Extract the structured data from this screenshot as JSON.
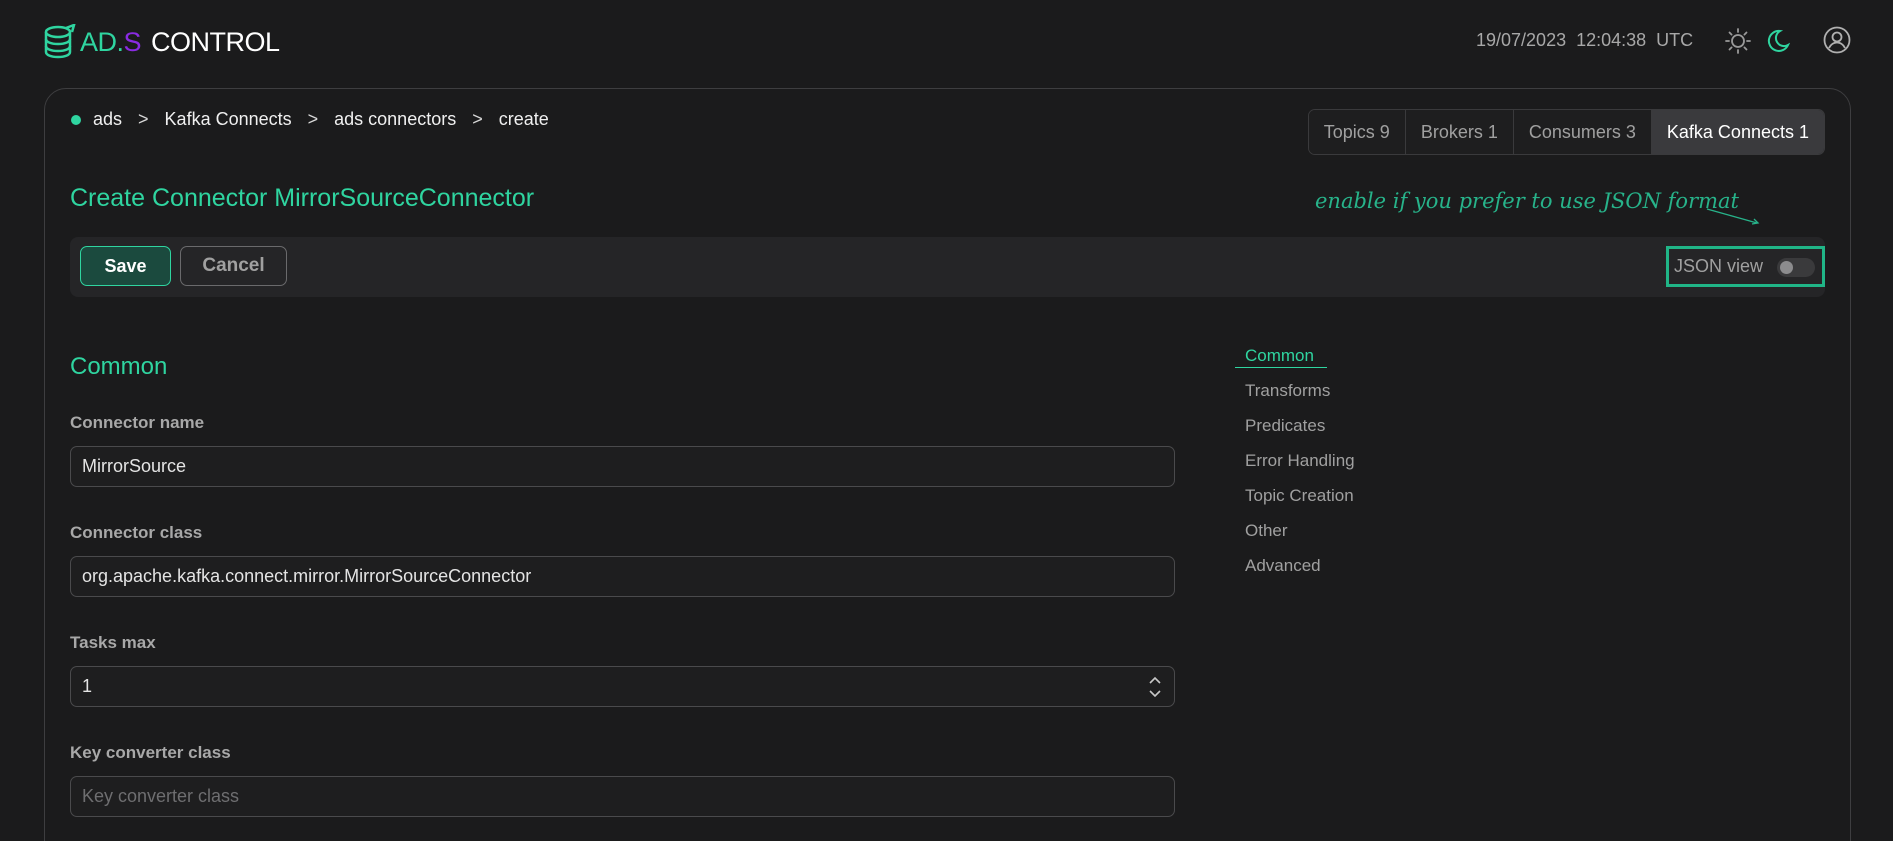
{
  "brand": {
    "ad": "AD",
    "dot": ".",
    "s": "S",
    "control": "CONTROL"
  },
  "header": {
    "date": "19/07/2023",
    "time": "12:04:38",
    "timezone": "UTC",
    "icons": [
      "logo-icon",
      "sun-icon",
      "moon-icon",
      "user-icon"
    ]
  },
  "breadcrumb": {
    "items": [
      "ads",
      "Kafka Connects",
      "ads connectors",
      "create"
    ],
    "separator": ">"
  },
  "top_tabs": [
    {
      "label": "Topics 9",
      "active": false
    },
    {
      "label": "Brokers 1",
      "active": false
    },
    {
      "label": "Consumers 3",
      "active": false
    },
    {
      "label": "Kafka Connects 1",
      "active": true
    }
  ],
  "page": {
    "title": "Create Connector MirrorSourceConnector",
    "hint": "enable if you prefer to use JSON format"
  },
  "toolbar": {
    "save_label": "Save",
    "cancel_label": "Cancel",
    "json_view_label": "JSON view",
    "json_view_enabled": false
  },
  "section": {
    "title": "Common"
  },
  "fields": {
    "connector_name": {
      "label": "Connector name",
      "value": "MirrorSource"
    },
    "connector_class": {
      "label": "Connector class",
      "value": "org.apache.kafka.connect.mirror.MirrorSourceConnector"
    },
    "tasks_max": {
      "label": "Tasks max",
      "value": "1"
    },
    "key_converter_class": {
      "label": "Key converter class",
      "placeholder": "Key converter class"
    }
  },
  "side_nav": {
    "items": [
      "Common",
      "Transforms",
      "Predicates",
      "Error Handling",
      "Topic Creation",
      "Other",
      "Advanced"
    ],
    "active": "Common"
  },
  "colors": {
    "accent": "#2fd5a0",
    "brand_purple": "#8a2be2",
    "background": "#1b1b1c",
    "hint_border": "#20b587"
  }
}
